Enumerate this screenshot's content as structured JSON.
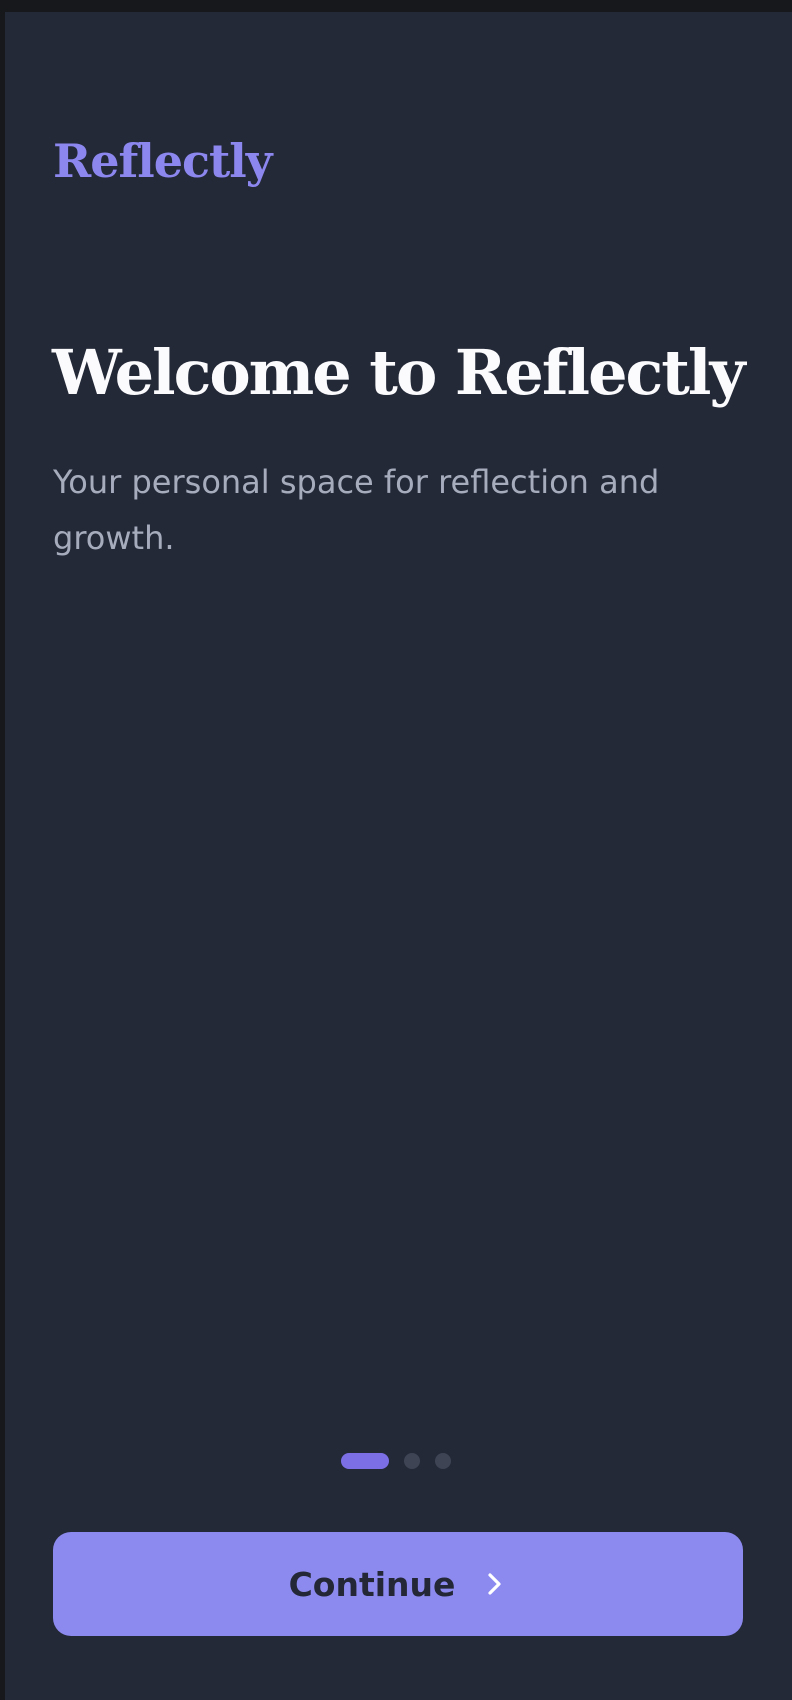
{
  "app": {
    "brand": "Reflectly"
  },
  "onboarding": {
    "title": "Welcome to Reflectly",
    "subtitle": "Your personal space for reflection and growth.",
    "pager": {
      "total": 3,
      "active_index": 0
    },
    "continue_label": "Continue",
    "continue_icon": "chevron-right-icon"
  },
  "colors": {
    "background": "#242938",
    "accent": "#8b87ef",
    "button": "#8c8aef",
    "active_dot": "#7c6fe6",
    "inactive_dot": "#3e4454",
    "title": "#fbfbfd",
    "subtitle": "#a7acbd"
  }
}
